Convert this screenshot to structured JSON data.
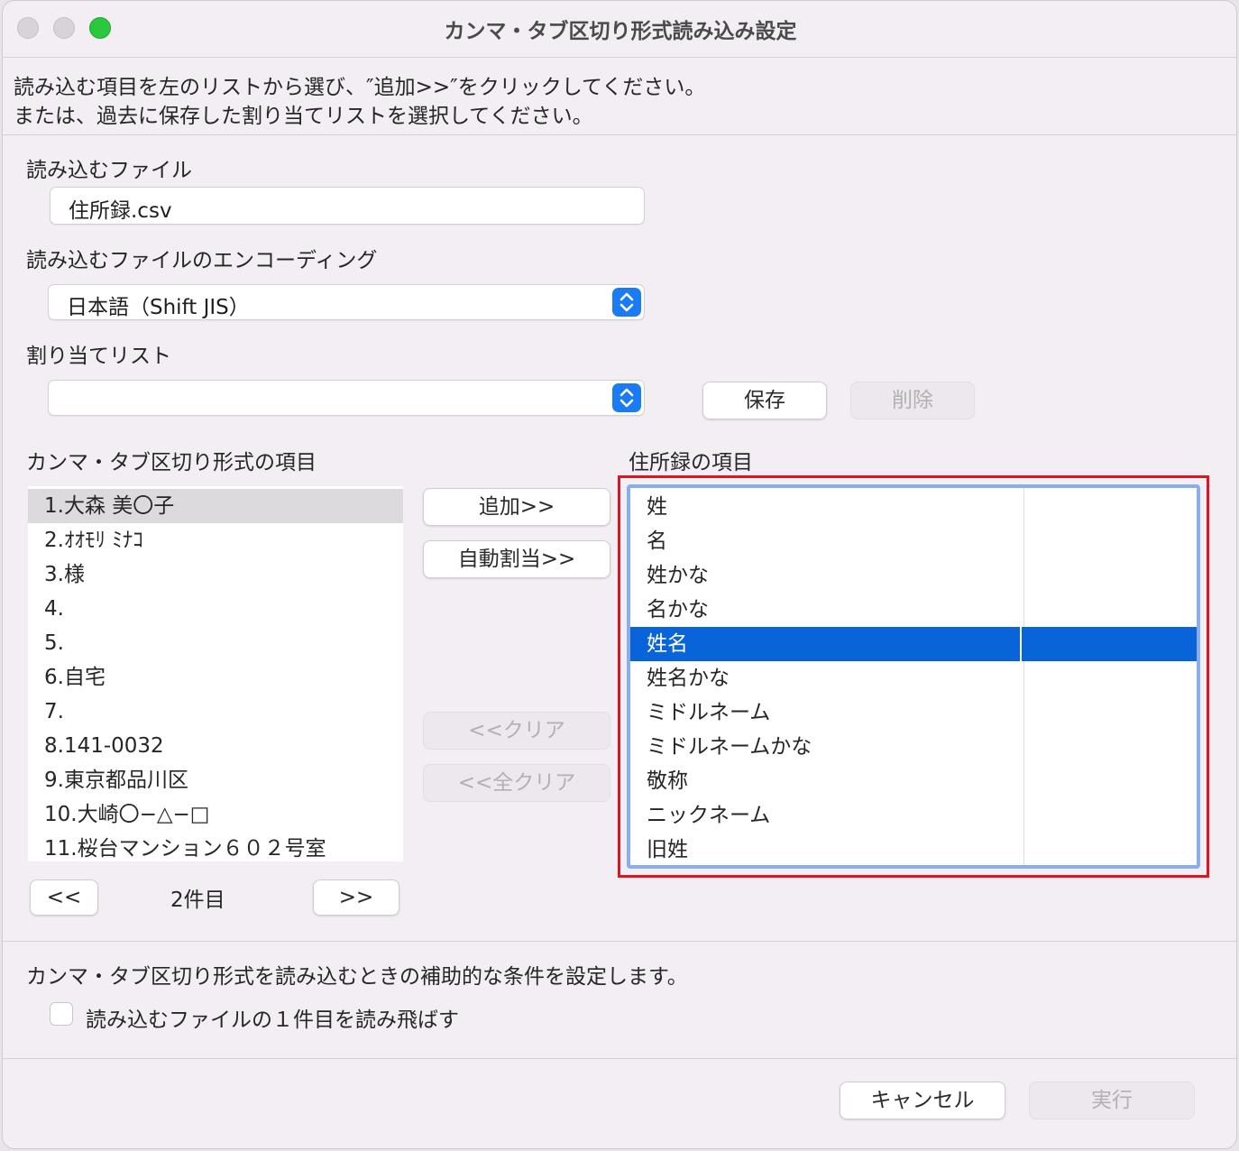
{
  "window": {
    "title": "カンマ・タブ区切り形式読み込み設定"
  },
  "instructions": {
    "line1": "読み込む項目を左のリストから選び、″追加>>″をクリックしてください。",
    "line2": "または、過去に保存した割り当てリストを選択してください。"
  },
  "file": {
    "label": "読み込むファイル",
    "value": "住所録.csv"
  },
  "encoding": {
    "label": "読み込むファイルのエンコーディング",
    "value": "日本語（Shift JIS）"
  },
  "assign_list": {
    "label": "割り当てリスト",
    "value": "",
    "save_label": "保存",
    "delete_label": "削除"
  },
  "source": {
    "label": "カンマ・タブ区切り形式の項目",
    "items": [
      "1.大森 美〇子",
      "2.ｵｵﾓﾘ ﾐﾅｺ",
      "3.様",
      "4.",
      "5.",
      "6.自宅",
      "7.",
      "8.141-0032",
      "9.東京都品川区",
      "10.大崎〇−△−□",
      "11.桜台マンション６０２号室"
    ],
    "selected_index": 0,
    "prev_label": "<<",
    "record_label": "2件目",
    "next_label": ">>"
  },
  "actions": {
    "add_label": "追加>>",
    "auto_label": "自動割当>>",
    "clear_label": "<<クリア",
    "clear_all_label": "<<全クリア"
  },
  "target": {
    "label": "住所録の項目",
    "items": [
      "姓",
      "名",
      "姓かな",
      "名かな",
      "姓名",
      "姓名かな",
      "ミドルネーム",
      "ミドルネームかな",
      "敬称",
      "ニックネーム",
      "旧姓"
    ],
    "selected_index": 4,
    "highlight_color": "#e0141e",
    "selection_color": "#0a64d9"
  },
  "options": {
    "description": "カンマ・タブ区切り形式を読み込むときの補助的な条件を設定します。",
    "skip_first_label": "読み込むファイルの１件目を読み飛ばす",
    "skip_first_checked": false
  },
  "footer": {
    "cancel_label": "キャンセル",
    "run_label": "実行"
  }
}
